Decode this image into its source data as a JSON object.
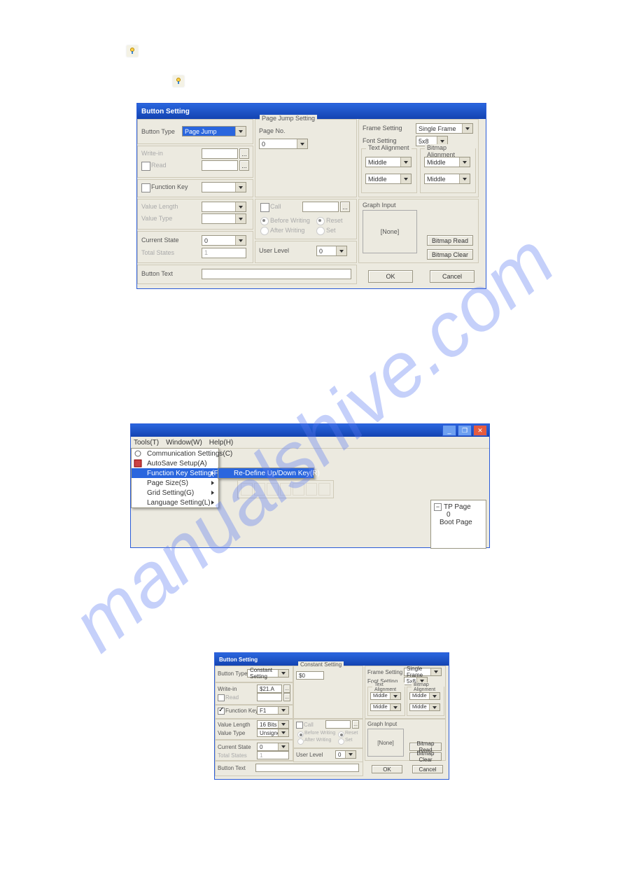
{
  "watermark": "manualshive.com",
  "dialog1": {
    "title": "Button Setting",
    "buttonType_label": "Button Type",
    "buttonType_value": "Page Jump",
    "pageJump_group": "Page Jump Setting",
    "pageNo_label": "Page No.",
    "pageNo_value": "0",
    "writeIn_label": "Write-in",
    "read_label": "Read",
    "functionKey_label": "Function Key",
    "valueLength_label": "Value Length",
    "valueType_label": "Value Type",
    "currentState_label": "Current State",
    "currentState_value": "0",
    "totalStates_label": "Total States",
    "totalStates_value": "1",
    "call_label": "Call",
    "beforeWriting_label": "Before Writing",
    "afterWriting_label": "After Writing",
    "reset_label": "Reset",
    "set_label": "Set",
    "userLevel_label": "User Level",
    "userLevel_value": "0",
    "buttonText_label": "Button Text",
    "frameSetting_label": "Frame Setting",
    "frameSetting_value": "Single Frame",
    "fontSetting_label": "Font Setting",
    "fontSetting_value": "5x8",
    "textAlign_group": "Text Alignment",
    "bitmapAlign_group": "Bitmap Alignment",
    "align_value": "Middle",
    "graphInput_label": "Graph Input",
    "none_label": "[None]",
    "bitmapRead_label": "Bitmap Read",
    "bitmapClear_label": "Bitmap Clear",
    "ok_label": "OK",
    "cancel_label": "Cancel"
  },
  "appwin": {
    "menu_tools": "Tools(T)",
    "menu_window": "Window(W)",
    "menu_help": "Help(H)",
    "mi_comm": "Communication Settings(C)",
    "mi_autosave": "AutoSave Setup(A)",
    "mi_funckey": "Function Key Setting(F)",
    "mi_pagesize": "Page Size(S)",
    "mi_grid": "Grid Setting(G)",
    "mi_lang": "Language Setting(L)",
    "mi_redefine": "Re-Define Up/Down Key(R)",
    "tree_tppage": "TP Page",
    "tree_0": "0",
    "tree_boot": "Boot Page"
  },
  "dialog2": {
    "title": "Button Setting",
    "buttonType_value": "Constant Setting",
    "constant_group": "Constant Setting",
    "constant_value": "$0",
    "writeIn_value": "$21.A",
    "functionKey_value": "F1",
    "valueLength_value": "16 Bits",
    "valueType_value": "Unsigned",
    "fontSetting_value": "5x8"
  }
}
